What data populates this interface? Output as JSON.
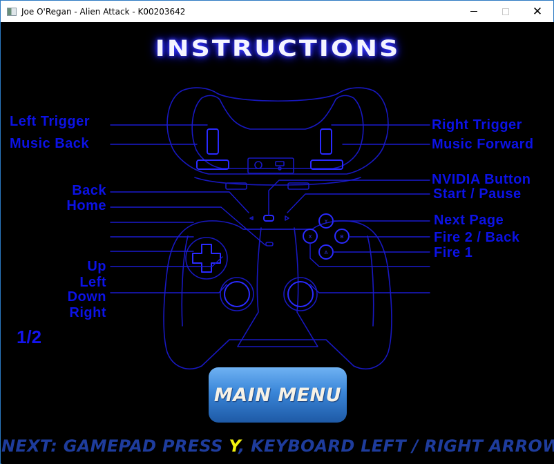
{
  "window": {
    "title": "Joe O'Regan - Alien Attack - K00203642",
    "controls": {
      "minimize": "minimize",
      "maximize": "maximize",
      "close": "✕"
    }
  },
  "screen": {
    "title": "INSTRUCTIONS",
    "page_indicator": "1/2",
    "labels_left": [
      {
        "id": "left-trigger",
        "text": "Left Trigger"
      },
      {
        "id": "music-back",
        "text": "Music Back"
      },
      {
        "id": "back",
        "text": "Back"
      },
      {
        "id": "home",
        "text": "Home"
      },
      {
        "id": "up",
        "text": "Up"
      },
      {
        "id": "left",
        "text": "Left"
      },
      {
        "id": "down",
        "text": "Down"
      },
      {
        "id": "right",
        "text": "Right"
      }
    ],
    "labels_right": [
      {
        "id": "right-trigger",
        "text": "Right Trigger"
      },
      {
        "id": "music-forward",
        "text": "Music Forward"
      },
      {
        "id": "nvidia-button",
        "text": "NVIDIA Button"
      },
      {
        "id": "start-pause",
        "text": "Start / Pause"
      },
      {
        "id": "next-page",
        "text": "Next Page"
      },
      {
        "id": "fire-2-back",
        "text": "Fire 2 / Back"
      },
      {
        "id": "fire-1",
        "text": "Fire 1"
      }
    ],
    "face_buttons": {
      "y": "Y",
      "x": "X",
      "b": "B",
      "a": "A"
    },
    "main_menu_button": "MAIN MENU",
    "footer": {
      "prefix": "NEXT: GAMEPAD PRESS ",
      "key": "Y",
      "suffix": ", KEYBOARD LEFT / RIGHT ARROWS"
    }
  },
  "colors": {
    "outline": "#1616c8",
    "label": "#0c12e6",
    "footer": "#1e3c9c",
    "footer_key": "#f2f20e",
    "button_top": "#6fb2f3",
    "button_bottom": "#1e5aa6"
  }
}
